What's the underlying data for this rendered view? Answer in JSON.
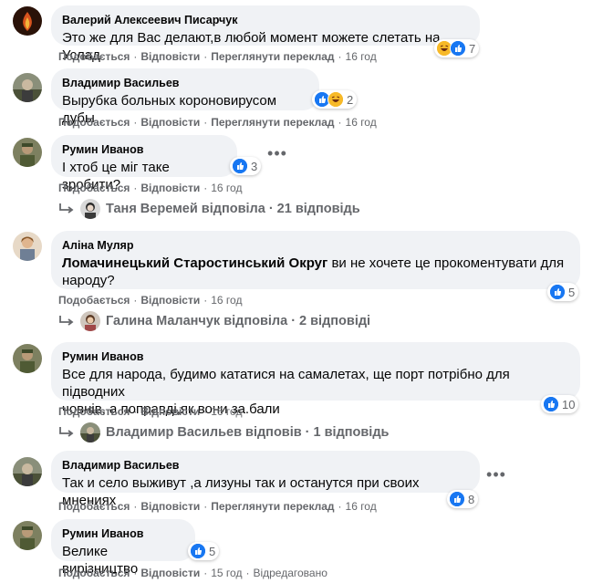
{
  "actions": {
    "like": "Подобається",
    "reply": "Відповісти",
    "translate": "Переглянути переклад",
    "edited": "Відредаговано"
  },
  "comments": [
    {
      "author": "Валерий Алексеевич Писарчук",
      "text": "Это же для Вас делают,в любой момент можете слетать на Услад",
      "reaction_count": "7",
      "time": "16 год"
    },
    {
      "author": "Владимир Васильев",
      "text": "Вырубка больных короновирусом дубы",
      "reaction_count": "2",
      "time": "16 год"
    },
    {
      "author": "Румин Иванов",
      "text": "І хтоб це міг таке зробити?",
      "reaction_count": "3",
      "time": "16 год",
      "replies": "Таня Веремей відповіла · 21 відповідь"
    },
    {
      "author": "Аліна Муляр",
      "mention": "Ломачинецький Старостинський Округ",
      "text_line1": " ви не хочете це прокоментувати для",
      "text_line2": "народу?",
      "reaction_count": "5",
      "time": "16 год",
      "replies": "Галина Маланчук відповіла · 2 відповіді"
    },
    {
      "author": "Румин Иванов",
      "text_line1": "Все для народа, будимо кататися на самалетах, ще порт потрібно для підводних",
      "text_line2": "човнів, а поправді,як вони за.бали",
      "reaction_count": "10",
      "time": "16 год",
      "replies": "Владимир Васильев відповів · 1 відповідь"
    },
    {
      "author": "Владимир Васильев",
      "text": "Так и село выживут ,а лизуны так и останутся при своих мнениях",
      "reaction_count": "8",
      "time": "16 год"
    },
    {
      "author": "Румин Иванов",
      "text": "Велике вирізництво",
      "reaction_count": "5",
      "time": "15 год"
    }
  ],
  "colors": {
    "like_blue": "#1877f2",
    "haha_yellow": "#f7b928",
    "bubble_gray": "#f0f2f5",
    "secondary_text": "#65676b"
  }
}
